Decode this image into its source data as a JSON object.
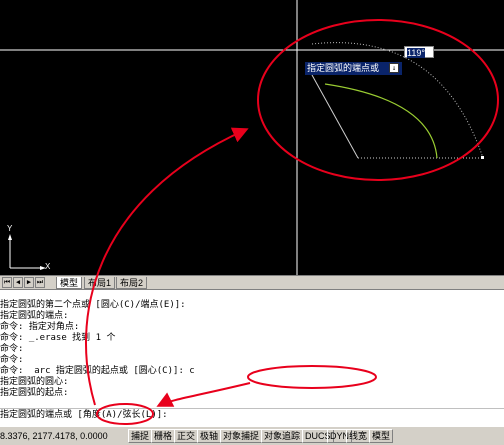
{
  "drawing": {
    "tooltip_prompt": "指定圆弧的端点或",
    "angle_value": "119°",
    "ucs_y": "Y",
    "ucs_x": "X"
  },
  "tabs": {
    "nav": [
      "⏮",
      "◀",
      "▶",
      "⏭"
    ],
    "items": [
      {
        "label": "模型",
        "active": true
      },
      {
        "label": "布局1",
        "active": false
      },
      {
        "label": "布局2",
        "active": false
      }
    ]
  },
  "command": {
    "history": [
      "指定圆弧的第二个点或 [圆心(C)/端点(E)]:",
      "指定圆弧的端点:",
      "命令: 指定对角点:",
      "命令: _.erase 找到 1 个",
      "命令:",
      "命令:",
      "命令:  arc 指定圆弧的起点或 [圆心(C)]: c",
      "指定圆弧的圆心:",
      "指定圆弧的起点:"
    ],
    "prompt": "指定圆弧的端点或 [角度(A)/弦长(L)]:"
  },
  "status": {
    "coords": "8.3376, 2177.4178, 0.0000",
    "buttons": [
      "捕捉",
      "栅格",
      "正交",
      "极轴",
      "对象捕捉",
      "对象追踪",
      "DUCS",
      "DYN",
      "线宽",
      "模型"
    ]
  },
  "colors": {
    "arc": "#9acd32",
    "annotation": "#e8001c",
    "canvas": "#000000"
  }
}
